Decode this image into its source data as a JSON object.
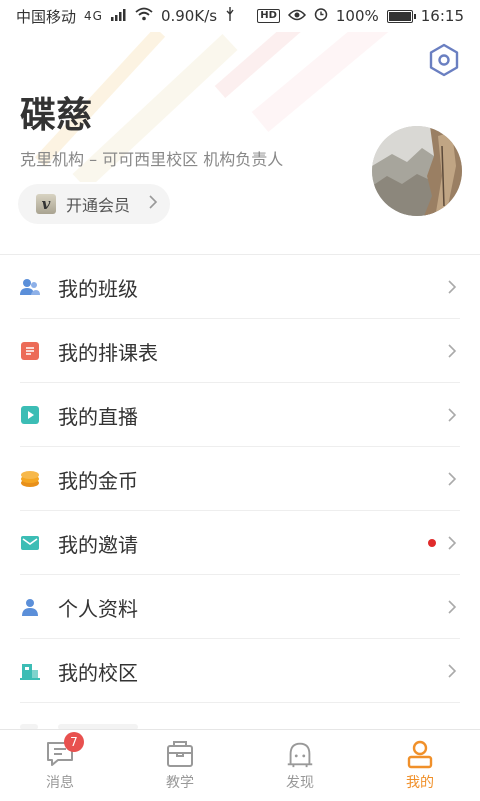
{
  "status_bar": {
    "carrier": "中国移动",
    "network": "4G",
    "speed": "0.90K/s",
    "hd": "HD",
    "battery": "100%",
    "time": "16:15"
  },
  "profile": {
    "name": "碟慈",
    "org": "克里机构 – 可可西里校区 机构负责人",
    "vip_badge": "v",
    "vip_label": "开通会员"
  },
  "menu": [
    {
      "label": "我的班级",
      "icon": "users-icon",
      "color": "#5b8fd9"
    },
    {
      "label": "我的排课表",
      "icon": "schedule-icon",
      "color": "#ec6b57"
    },
    {
      "label": "我的直播",
      "icon": "live-icon",
      "color": "#3cbdb5"
    },
    {
      "label": "我的金币",
      "icon": "coins-icon",
      "color": "#f5a623"
    },
    {
      "label": "我的邀请",
      "icon": "mail-icon",
      "color": "#3cbdb5",
      "has_dot": true
    },
    {
      "label": "个人资料",
      "icon": "person-icon",
      "color": "#5b8fd9"
    },
    {
      "label": "我的校区",
      "icon": "campus-icon",
      "color": "#3cbdb5"
    }
  ],
  "tabs": [
    {
      "label": "消息",
      "icon": "message-icon",
      "badge": "7",
      "active": false
    },
    {
      "label": "教学",
      "icon": "teaching-icon",
      "active": false
    },
    {
      "label": "发现",
      "icon": "discover-icon",
      "active": false
    },
    {
      "label": "我的",
      "icon": "profile-icon",
      "active": true
    }
  ],
  "colors": {
    "accent": "#f0902a",
    "settings_icon": "#6a7fc1",
    "badge": "#e8514f"
  }
}
